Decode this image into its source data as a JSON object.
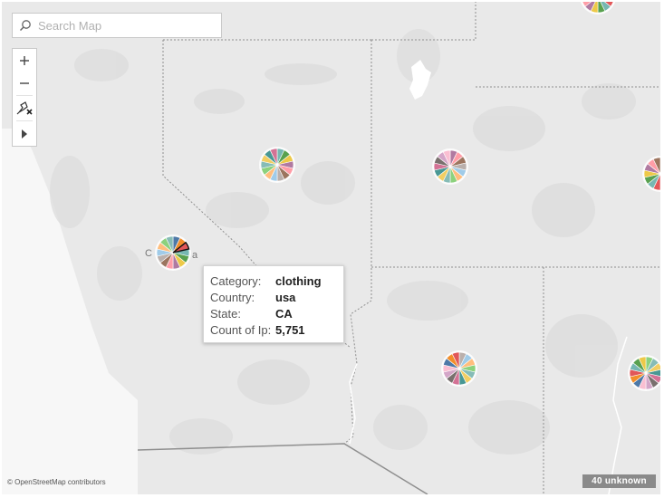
{
  "search": {
    "placeholder": "Search Map"
  },
  "toolbar": {
    "zoom_in_icon": "plus-icon",
    "zoom_out_icon": "minus-icon",
    "pin_icon": "pin-reset-icon",
    "expand_icon": "triangle-right-icon"
  },
  "attribution": "© OpenStreetMap contributors",
  "unknown_badge": "40 unknown",
  "state_label_fragments": {
    "left": "C",
    "right": "a"
  },
  "tooltip": {
    "rows": [
      {
        "label": "Category:",
        "value": "clothing"
      },
      {
        "label": "Country:",
        "value": "usa"
      },
      {
        "label": "State:",
        "value": "CA"
      },
      {
        "label": "Count of Ip:",
        "value": "5,751"
      }
    ]
  },
  "colors": {
    "map_background": "#e9e9e9",
    "border_line": "#8f8f8f",
    "badge": "#8a8a8a",
    "pie_palette": [
      "#4e79a7",
      "#f28e2b",
      "#e15759",
      "#76b7b2",
      "#59a14f",
      "#edc948",
      "#b07aa1",
      "#ff9da7",
      "#9c755f",
      "#bab0ac",
      "#a0cbe8",
      "#ffbe7d",
      "#8cd17d",
      "#86bcb6",
      "#f1ce63",
      "#499894",
      "#d37295",
      "#79706e",
      "#d4a6c8",
      "#fabfd2"
    ]
  }
}
